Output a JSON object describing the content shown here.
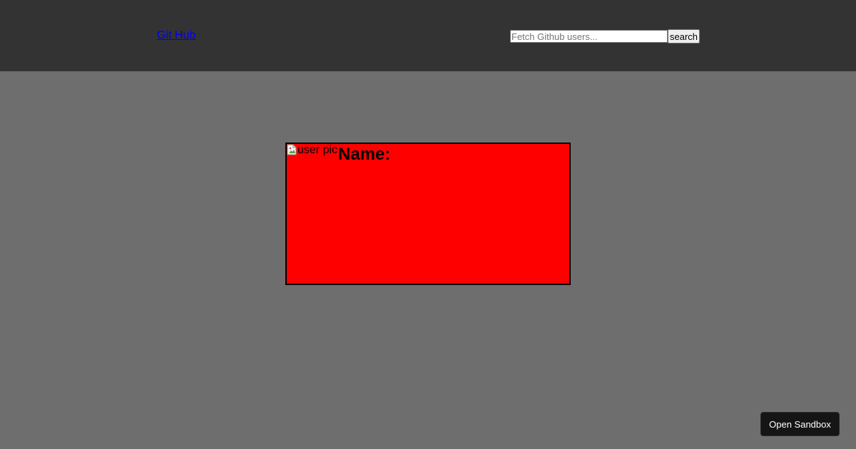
{
  "header": {
    "brand_link": "Git Hub",
    "search": {
      "placeholder": "Fetch Github users...",
      "value": "",
      "button_label": "search"
    }
  },
  "user_card": {
    "image_alt": "user pic",
    "name_label": "Name:"
  },
  "sandbox": {
    "button_label": "Open Sandbox"
  },
  "colors": {
    "header_bg": "#333333",
    "page_bg": "#6e6e6e",
    "card_bg": "#ff0000",
    "card_border": "#000000",
    "link": "#0000ee",
    "sandbox_bg": "#151515"
  },
  "icons": {
    "user_pic": "broken-image-icon"
  }
}
